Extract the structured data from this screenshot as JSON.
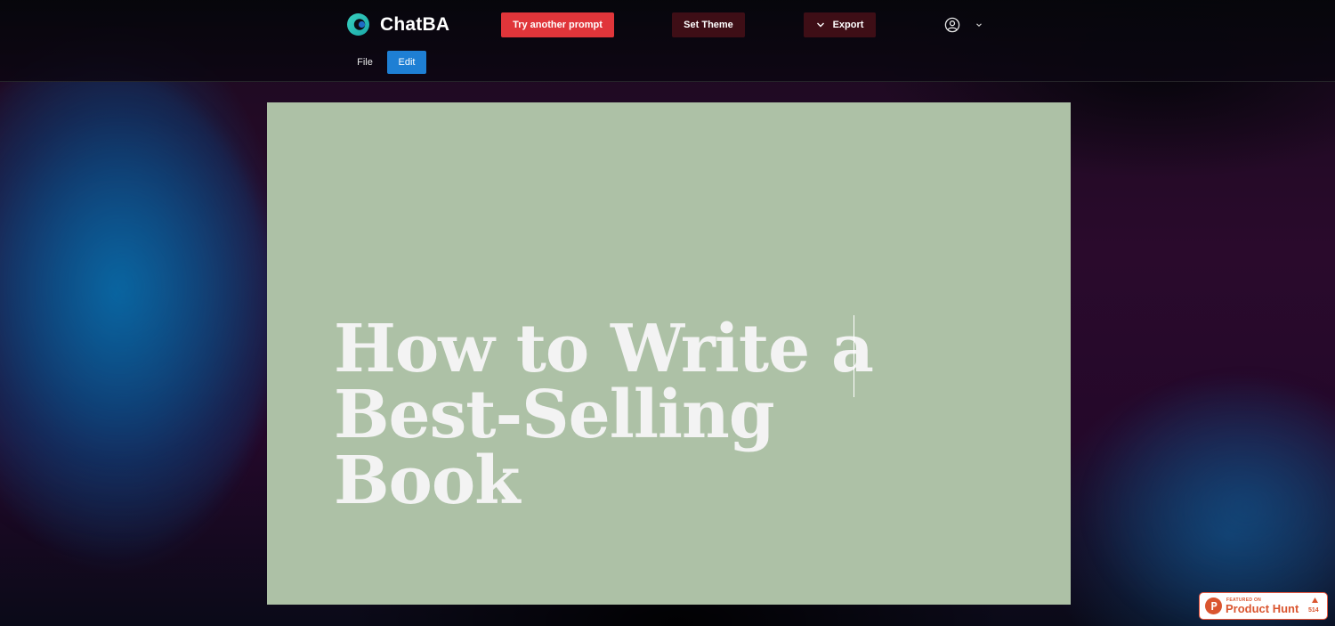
{
  "app": {
    "brand": "ChatBA"
  },
  "toolbar": {
    "try_label": "Try another prompt",
    "theme_label": "Set Theme",
    "export_label": "Export"
  },
  "menu": {
    "file_label": "File",
    "edit_label": "Edit",
    "active": "Edit"
  },
  "slide": {
    "title": "How to Write a Best-Selling Book",
    "background_color": "#adc1a6"
  },
  "badge": {
    "featured": "FEATURED ON",
    "name": "Product Hunt",
    "count": "514"
  },
  "colors": {
    "try_button": "#e0353a",
    "dark_button": "#3e0e16",
    "edit_active": "#1e7fd4",
    "product_hunt": "#da552f"
  },
  "icons": {
    "logo": "chatba-logo-icon",
    "export": "chevron-down-icon",
    "user": "user-circle-icon",
    "user_menu": "chevron-down-icon",
    "badge_logo": "product-hunt-logo-icon",
    "badge_upvote": "upvote-triangle-icon"
  }
}
